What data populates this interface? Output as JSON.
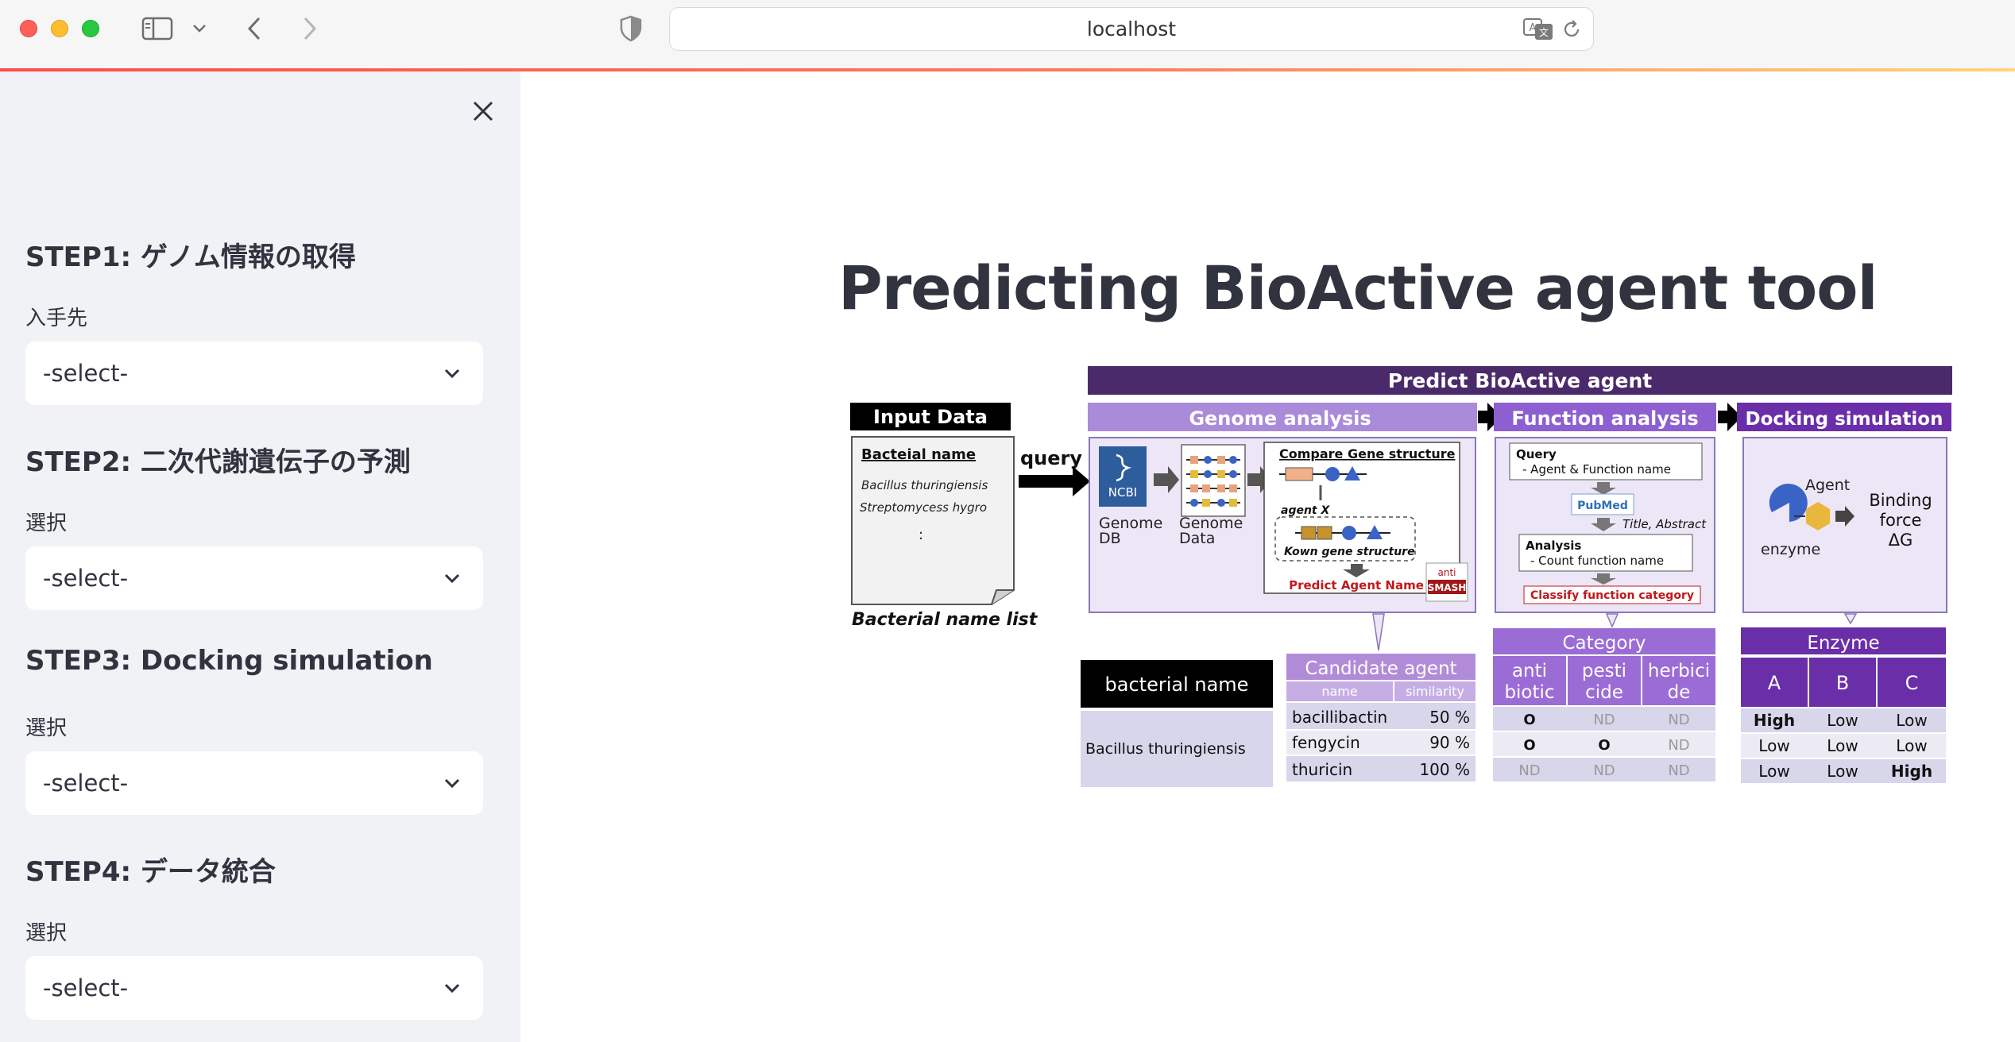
{
  "browser": {
    "url": "localhost",
    "icons": [
      "sidebar-icon",
      "chevron-down-icon",
      "back-icon",
      "forward-icon",
      "shield-icon",
      "translate-icon",
      "reload-icon"
    ]
  },
  "sidebar": {
    "steps": [
      {
        "title": "STEP1: ゲノム情報の取得",
        "label": "入手先",
        "value": "-select-"
      },
      {
        "title": "STEP2: 二次代謝遺伝子の予測",
        "label": "選択",
        "value": "-select-"
      },
      {
        "title": "STEP3: Docking simulation",
        "label": "選択",
        "value": "-select-"
      },
      {
        "title": "STEP4: データ統合",
        "label": "選択",
        "value": "-select-"
      }
    ]
  },
  "main": {
    "title": "Predicting BioActive agent tool"
  },
  "diagram": {
    "header": "Predict BioActive agent",
    "input": {
      "title": "Input Data",
      "doc_title": "Bacteial name",
      "line1": "Bacillus thuringiensis",
      "line2": "Streptomycess hygro",
      "line3": ":",
      "caption": "Bacterial name list",
      "query": "query"
    },
    "genome": {
      "title": "Genome analysis",
      "ncbi": "NCBI",
      "db_label1": "Genome",
      "db_label2": "DB",
      "data_label1": "Genome",
      "data_label2": "Data",
      "compare": "Compare Gene structure",
      "agent_x": "agent X",
      "known": "Kown gene structure",
      "predict": "Predict Agent Name",
      "anti": "anti",
      "smash": "SMASH"
    },
    "function": {
      "title": "Function analysis",
      "query": "Query",
      "query_item": "- Agent & Function name",
      "pubmed": "PubMed",
      "title_abstract": "Title, Abstract",
      "analysis": "Analysis",
      "analysis_item": "- Count function name",
      "classify": "Classify function category"
    },
    "docking": {
      "title": "Docking simulation",
      "agent": "Agent",
      "enzyme": "enzyme",
      "binding1": "Binding",
      "binding2": "force",
      "binding3": "ΔG"
    },
    "results": {
      "bacterial_header": "bacterial name",
      "bacterial_name": "Bacillus thuringiensis",
      "candidate_title": "Candidate agent",
      "candidate_cols": [
        "name",
        "similarity"
      ],
      "candidate_rows": [
        [
          "bacillibactin",
          "50 %"
        ],
        [
          "fengycin",
          "90 %"
        ],
        [
          "thuricin",
          "100 %"
        ]
      ],
      "category_title": "Category",
      "category_cols": [
        [
          "anti",
          "biotic"
        ],
        [
          "pesti",
          "cide"
        ],
        [
          "herbici",
          "de"
        ]
      ],
      "category_rows": [
        [
          "O",
          "ND",
          "ND"
        ],
        [
          "O",
          "O",
          "ND"
        ],
        [
          "ND",
          "ND",
          "ND"
        ]
      ],
      "enzyme_title": "Enzyme",
      "enzyme_cols": [
        "A",
        "B",
        "C"
      ],
      "enzyme_rows": [
        [
          "High",
          "Low",
          "Low"
        ],
        [
          "Low",
          "Low",
          "Low"
        ],
        [
          "Low",
          "Low",
          "High"
        ]
      ]
    }
  }
}
